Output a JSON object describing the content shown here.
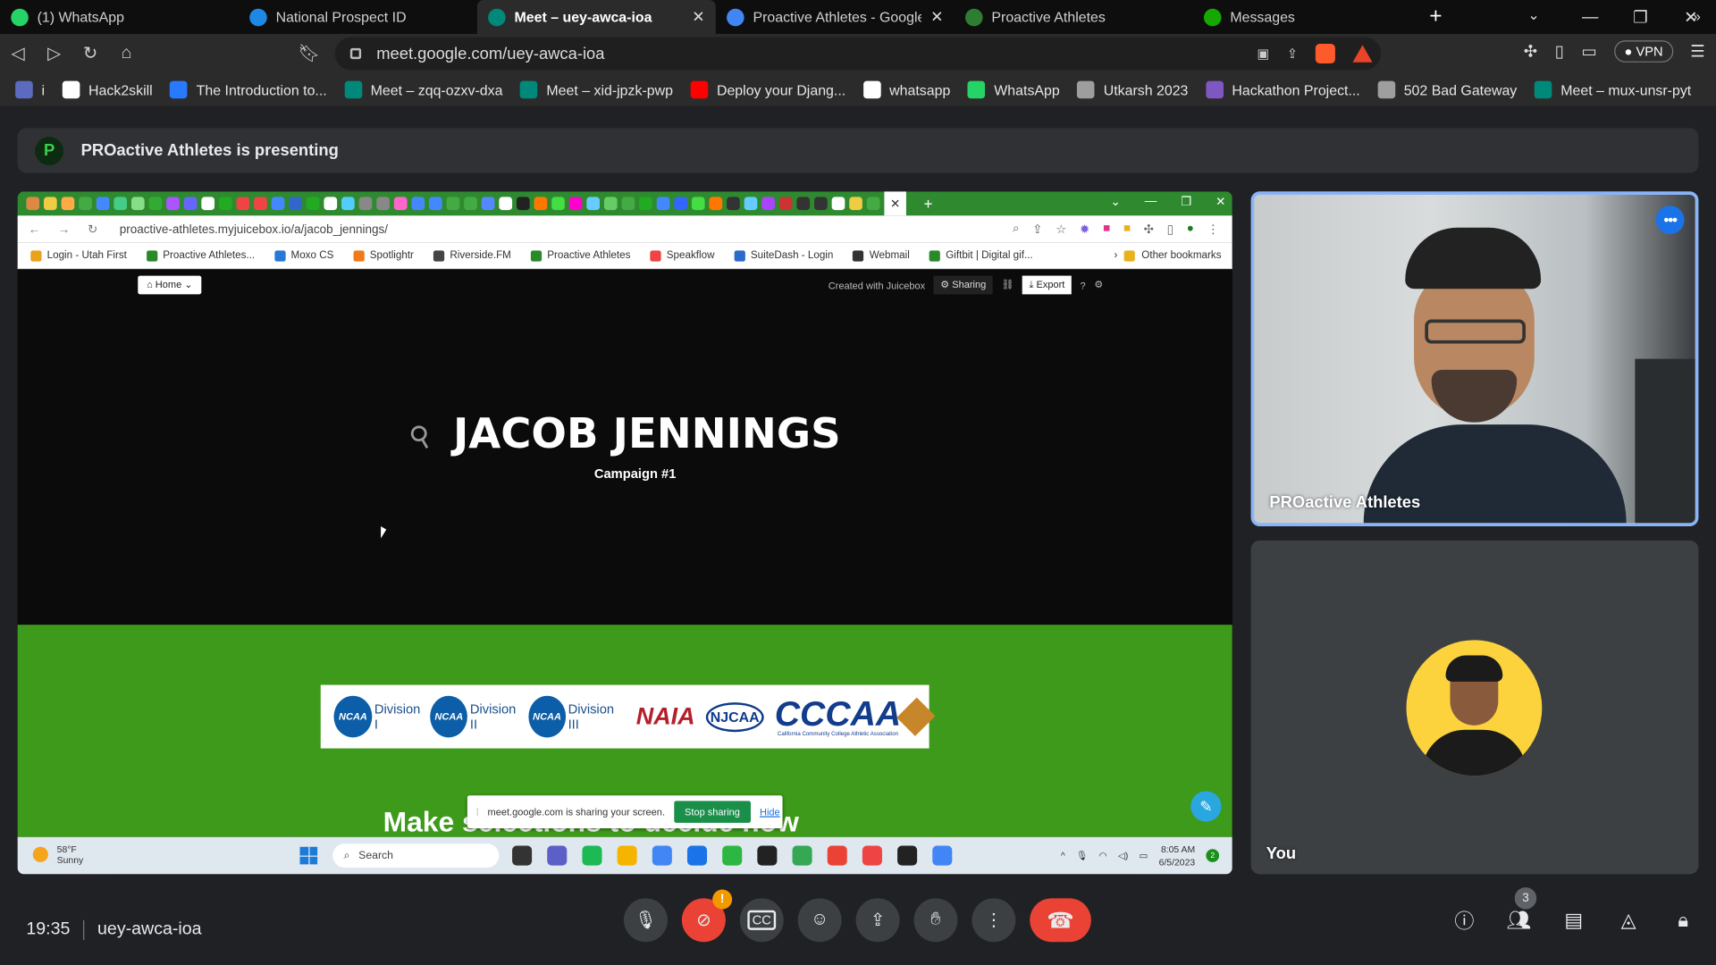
{
  "browser": {
    "tabs": [
      {
        "label": "(1) WhatsApp",
        "icon": "whatsapp-icon",
        "color": "#25d366",
        "active": false
      },
      {
        "label": "National Prospect ID",
        "icon": "globe-icon",
        "color": "#1e88e5",
        "active": false
      },
      {
        "label": "Meet – uey-awca-ioa",
        "icon": "meet-icon",
        "color": "#00897b",
        "active": true
      },
      {
        "label": "Proactive Athletes - Google D",
        "icon": "docs-icon",
        "color": "#4285f4",
        "active": false
      },
      {
        "label": "Proactive Athletes",
        "icon": "proactive-icon",
        "color": "#2e7d32",
        "active": false
      },
      {
        "label": "Messages",
        "icon": "upwork-icon",
        "color": "#14a800",
        "active": false
      }
    ],
    "url": "meet.google.com/uey-awca-ioa",
    "vpn_label": "VPN",
    "bookmarks": [
      {
        "label": "i",
        "color": "#5c6bc0"
      },
      {
        "label": "Hack2skill",
        "color": "#ffffff"
      },
      {
        "label": "The Introduction to...",
        "color": "#2979ff"
      },
      {
        "label": "Meet – zqq-ozxv-dxa",
        "color": "#00897b"
      },
      {
        "label": "Meet – xid-jpzk-pwp",
        "color": "#00897b"
      },
      {
        "label": "Deploy your Djang...",
        "color": "#ff0000"
      },
      {
        "label": "whatsapp",
        "color": "#ffffff"
      },
      {
        "label": "WhatsApp",
        "color": "#25d366"
      },
      {
        "label": "Utkarsh 2023",
        "color": "#9e9e9e"
      },
      {
        "label": "Hackathon Project...",
        "color": "#7e57c2"
      },
      {
        "label": "502 Bad Gateway",
        "color": "#9e9e9e"
      },
      {
        "label": "Meet – mux-unsr-pyt",
        "color": "#00897b"
      }
    ]
  },
  "meet": {
    "presenting_text": "PROactive Athletes is presenting",
    "presenter_initial": "P",
    "presenter_name": "PROactive Athletes",
    "you_label": "You",
    "time": "19:35",
    "meeting_code": "uey-awca-ioa",
    "participant_count": "3"
  },
  "shared_screen": {
    "url": "proactive-athletes.myjuicebox.io/a/jacob_jennings/",
    "bookmarks": [
      "Login - Utah First",
      "Proactive Athletes...",
      "Moxo CS",
      "Spotlightr",
      "Riverside.FM",
      "Proactive Athletes",
      "Speakflow",
      "SuiteDash - Login",
      "Webmail",
      "Giftbit | Digital gif..."
    ],
    "other_bookmarks": "Other bookmarks",
    "home_label": "Home",
    "created_with": "Created with Juicebox",
    "sharing_label": "Sharing",
    "export_label": "Export",
    "player_name": "JACOB JENNINGS",
    "campaign": "Campaign #1",
    "logos": {
      "ncaa": "NCAA",
      "div1": "Division I",
      "div2": "Division II",
      "div3": "Division III",
      "naia": "NAIA",
      "njcaa": "NJCAA",
      "cccaa": "CCCAA",
      "cccaa_sub": "California Community College Athletic Association"
    },
    "make_text": "Make selections to decide how",
    "share_notice": "meet.google.com is sharing your screen.",
    "stop_sharing": "Stop sharing",
    "hide": "Hide",
    "weather_temp": "58°F",
    "weather_desc": "Sunny",
    "search": "Search",
    "clock_time": "8:05 AM",
    "clock_date": "6/5/2023",
    "notif_count": "2"
  }
}
